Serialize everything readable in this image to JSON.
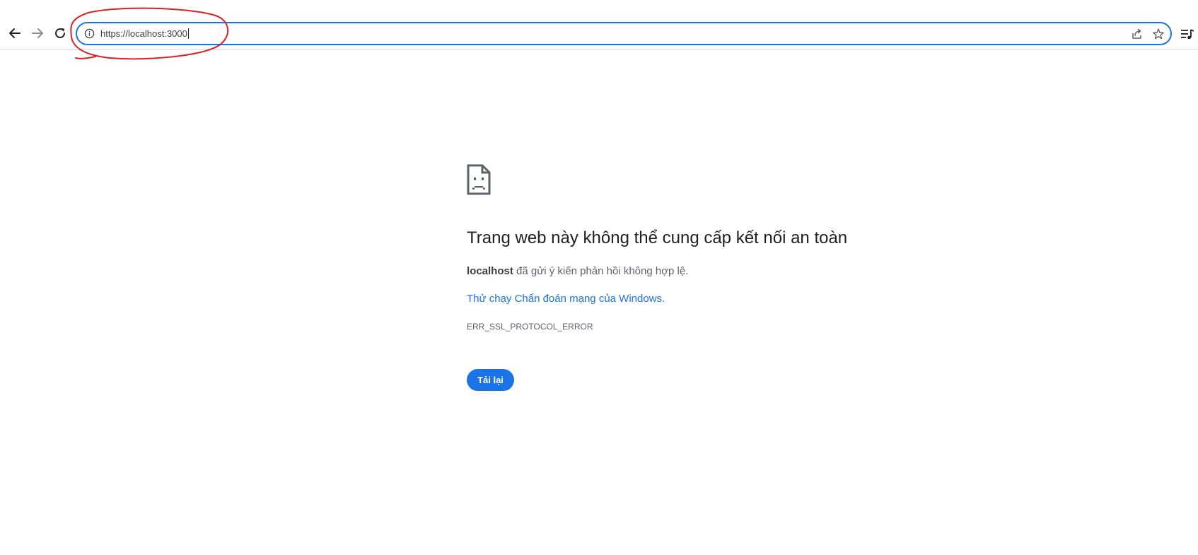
{
  "browser": {
    "url": "https://localhost:3000",
    "icons": {
      "back": "back-arrow-icon",
      "forward": "forward-arrow-icon",
      "reload": "reload-icon",
      "site_info": "info-icon",
      "share": "share-icon",
      "bookmark": "star-icon",
      "reading_list": "reading-list-icon"
    },
    "colors": {
      "accent": "#1a73e8",
      "annotation": "#e02020"
    }
  },
  "error_page": {
    "icon": "sad-page-icon",
    "title": "Trang web này không thể cung cấp kết nối an toàn",
    "host": "localhost",
    "description": " đã gửi ý kiến phản hồi không hợp lệ.",
    "diagnostics_link": "Thử chạy Chẩn đoán mạng của Windows.",
    "error_code": "ERR_SSL_PROTOCOL_ERROR",
    "reload_label": "Tải lại"
  }
}
